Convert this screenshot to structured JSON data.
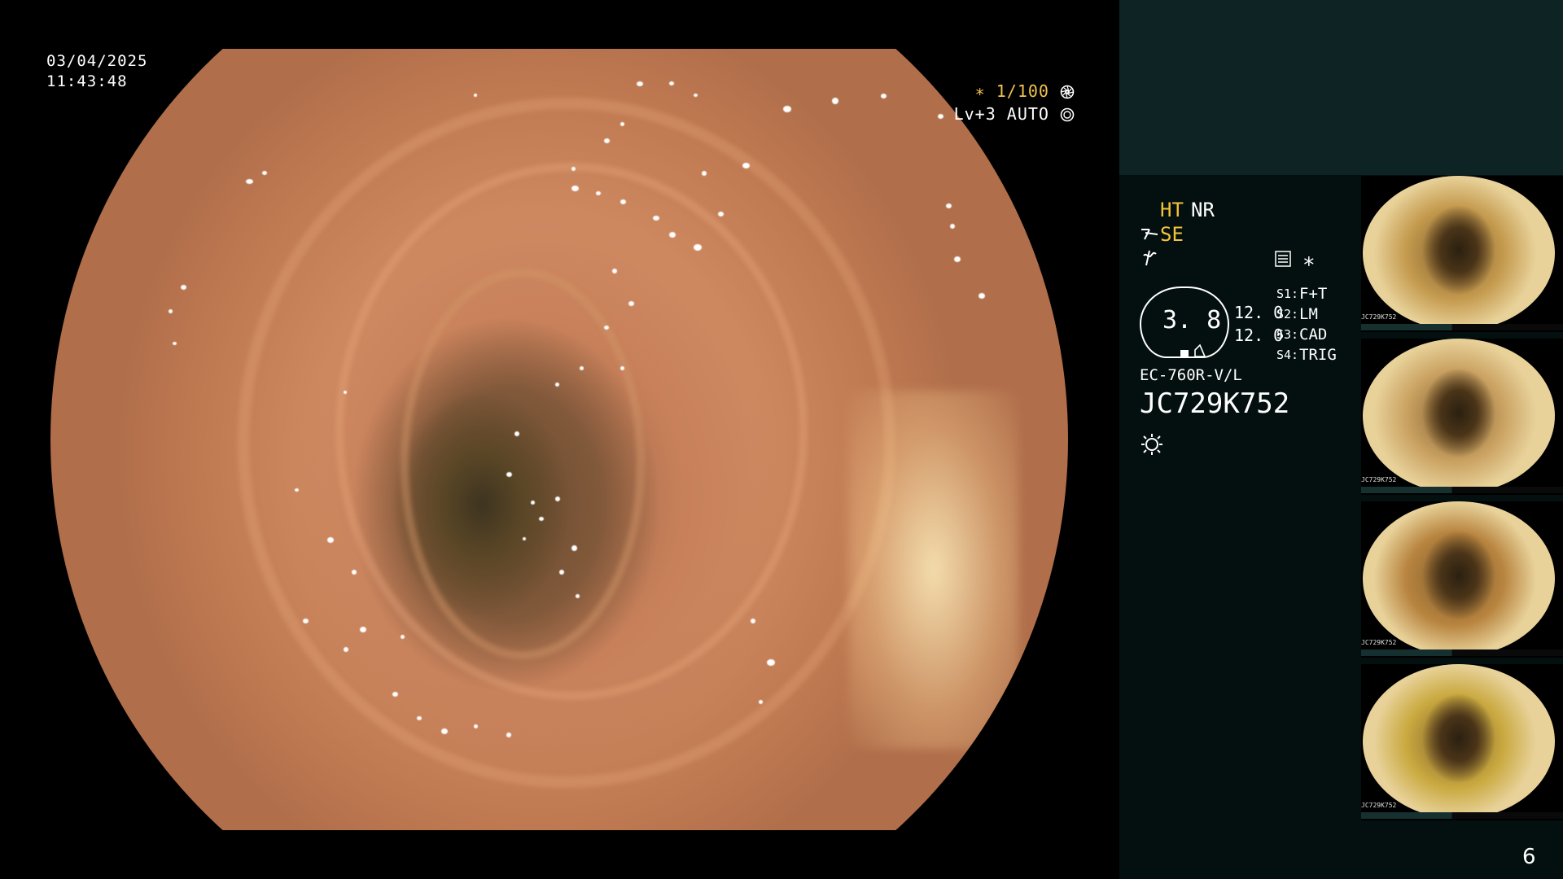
{
  "overlay": {
    "date": "03/04/2025",
    "time": "11:43:48",
    "shutter": "∗ 1/100",
    "level": "Lv+3  AUTO"
  },
  "panel": {
    "ht": "HT",
    "nr": "NR",
    "se": "SE",
    "bubble_value": "3. 8",
    "value_top": "12. 0",
    "value_bottom": "12. 0",
    "s1_label": "S1:",
    "s1_value": "F+T",
    "s2_label": "S2:",
    "s2_value": "LM",
    "s3_label": "S3:",
    "s3_value": "CAD",
    "s4_label": "S4:",
    "s4_value": "TRIG",
    "scope_model": "EC-760R-V/L",
    "serial": "JC729K752",
    "star": "∗"
  },
  "thumbnails": [
    {
      "caption": "JC729K752",
      "tone": "#c49a4e"
    },
    {
      "caption": "JC729K752",
      "tone": "#caa262"
    },
    {
      "caption": "JC729K752",
      "tone": "#b8843f"
    },
    {
      "caption": "JC729K752",
      "tone": "#c9a93f"
    }
  ],
  "page_number": "6"
}
